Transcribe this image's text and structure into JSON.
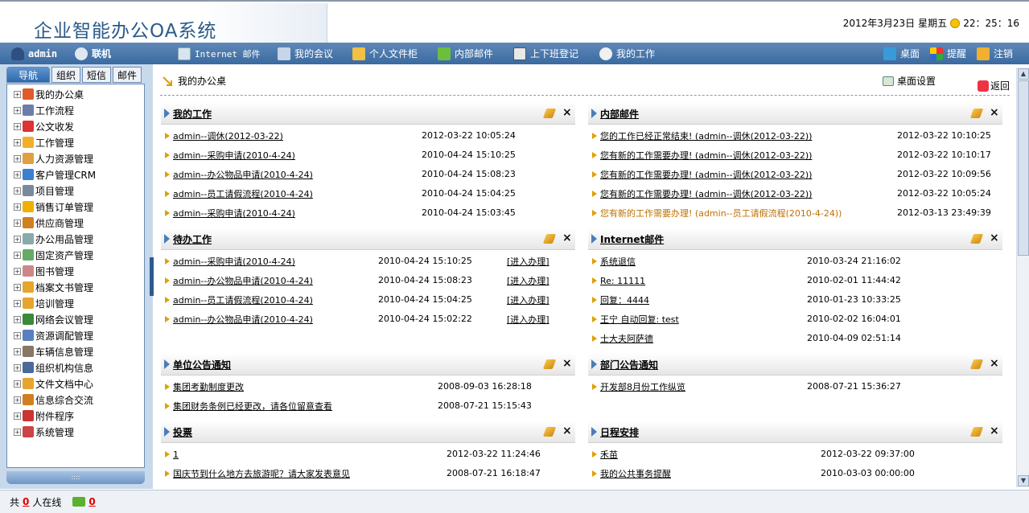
{
  "header": {
    "logo_text": "企业智能办公OA系统",
    "date": "2012年3月23日",
    "weekday": "星期五",
    "time": "22：25：16"
  },
  "navbar": {
    "user": "admin",
    "status": "联机",
    "items": [
      {
        "label": "Internet 邮件",
        "icon": "internet-mail-icon"
      },
      {
        "label": "我的会议",
        "icon": "meeting-icon"
      },
      {
        "label": "个人文件柜",
        "icon": "file-cabinet-icon"
      },
      {
        "label": "内部邮件",
        "icon": "internal-mail-icon"
      },
      {
        "label": "上下班登记",
        "icon": "attendance-icon"
      },
      {
        "label": "我的工作",
        "icon": "my-work-icon"
      }
    ],
    "right": [
      {
        "label": "桌面",
        "icon": "desktop-icon"
      },
      {
        "label": "提醒",
        "icon": "reminder-icon"
      },
      {
        "label": "注销",
        "icon": "logout-icon"
      }
    ]
  },
  "sidebar": {
    "tabs": [
      "导航",
      "组织",
      "短信",
      "邮件"
    ],
    "items": [
      "我的办公桌",
      "工作流程",
      "公文收发",
      "工作管理",
      "人力资源管理",
      "客户管理CRM",
      "项目管理",
      "销售订单管理",
      "供应商管理",
      "办公用品管理",
      "固定资产管理",
      "图书管理",
      "档案文书管理",
      "培训管理",
      "网络会议管理",
      "资源调配管理",
      "车辆信息管理",
      "组织机构信息",
      "文件文档中心",
      "信息综合交流",
      "附件程序",
      "系统管理"
    ]
  },
  "main": {
    "title": "我的办公桌",
    "desk_settings": "桌面设置",
    "back": "返回",
    "panels": {
      "my_work": {
        "title": "我的工作",
        "rows": [
          {
            "text": "admin--调休(2012-03-22)",
            "date": "2012-03-22 10:05:24"
          },
          {
            "text": "admin--采购申请(2010-4-24)",
            "date": "2010-04-24 15:10:25"
          },
          {
            "text": "admin--办公物品申请(2010-4-24)",
            "date": "2010-04-24 15:08:23"
          },
          {
            "text": "admin--员工请假流程(2010-4-24)",
            "date": "2010-04-24 15:04:25"
          },
          {
            "text": "admin--采购申请(2010-4-24)",
            "date": "2010-04-24 15:03:45"
          }
        ]
      },
      "internal_mail": {
        "title": "内部邮件",
        "rows": [
          {
            "text": "您的工作已经正常结束! (admin--调休(2012-03-22))",
            "date": "2012-03-22 10:10:25"
          },
          {
            "text": "您有新的工作需要办理! (admin--调休(2012-03-22))",
            "date": "2012-03-22 10:10:17"
          },
          {
            "text": "您有新的工作需要办理! (admin--调休(2012-03-22))",
            "date": "2012-03-22 10:09:56"
          },
          {
            "text": "您有新的工作需要办理! (admin--调休(2012-03-22))",
            "date": "2012-03-22 10:05:24"
          },
          {
            "text": "您有新的工作需要办理! (admin--员工请假流程(2010-4-24))",
            "date": "2012-03-13 23:49:39"
          }
        ]
      },
      "todo": {
        "title": "待办工作",
        "action": "[进入办理]",
        "rows": [
          {
            "text": "admin--采购申请(2010-4-24)",
            "date": "2010-04-24 15:10:25"
          },
          {
            "text": "admin--办公物品申请(2010-4-24)",
            "date": "2010-04-24 15:08:23"
          },
          {
            "text": "admin--员工请假流程(2010-4-24)",
            "date": "2010-04-24 15:04:25"
          },
          {
            "text": "admin--办公物品申请(2010-4-24)",
            "date": "2010-04-24 15:02:22"
          }
        ]
      },
      "internet_mail": {
        "title": "Internet邮件",
        "rows": [
          {
            "text": "系统退信",
            "date": "2010-03-24 21:16:02"
          },
          {
            "text": "Re: 11111",
            "date": "2010-02-01 11:44:42"
          },
          {
            "text": "回复：4444",
            "date": "2010-01-23 10:33:25"
          },
          {
            "text": "王宁 自动回复: test",
            "date": "2010-02-02 16:04:01"
          },
          {
            "text": "士大夫阿萨德",
            "date": "2010-04-09 02:51:14"
          }
        ]
      },
      "unit_notice": {
        "title": "单位公告通知",
        "rows": [
          {
            "text": "集团考勤制度更改",
            "date": "2008-09-03 16:28:18"
          },
          {
            "text": "集团财务条例已经更改，请各位留意查看",
            "date": "2008-07-21 15:15:43"
          }
        ]
      },
      "dept_notice": {
        "title": "部门公告通知",
        "rows": [
          {
            "text": "开发部8月份工作纵览",
            "date": "2008-07-21 15:36:27"
          }
        ]
      },
      "vote": {
        "title": "投票",
        "rows": [
          {
            "text": "1",
            "date": "2012-03-22 11:24:46"
          },
          {
            "text": "国庆节到什么地方去旅游呢？请大家发表意见",
            "date": "2008-07-21 16:18:47"
          }
        ]
      },
      "schedule": {
        "title": "日程安排",
        "rows": [
          {
            "text": "禾苗",
            "date": "2012-03-22 09:37:00"
          },
          {
            "text": "我的公共事务提醒",
            "date": "2010-03-03 00:00:00"
          }
        ]
      }
    }
  },
  "statusbar": {
    "prefix": "共",
    "online_count": "0",
    "online_label": "人在线",
    "mail_count": "0"
  }
}
